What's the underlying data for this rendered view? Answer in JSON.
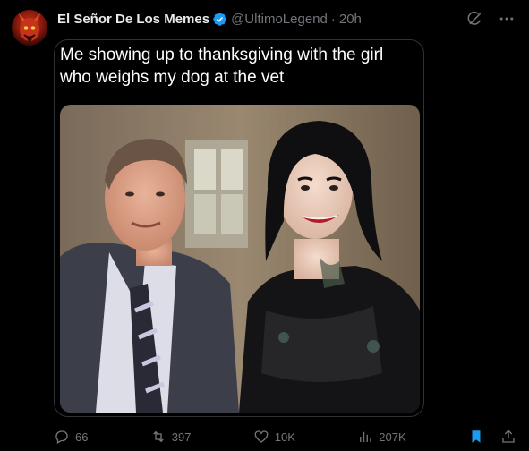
{
  "tweet": {
    "display_name": "El Señor De Los Memes",
    "handle": "@UltimoLegend",
    "separator": "·",
    "time": "20h",
    "verified_color": "#1d9bf0"
  },
  "meme": {
    "caption": "Me showing up to thanksgiving with the girl who weighs my dog at the vet"
  },
  "actions": {
    "replies": "66",
    "retweets": "397",
    "likes": "10K",
    "views": "207K",
    "bookmark_color": "#1d9bf0"
  },
  "icons": {
    "grok": "grok-icon",
    "more": "more-icon",
    "reply": "reply-icon",
    "retweet": "retweet-icon",
    "like": "like-icon",
    "views": "views-icon",
    "bookmark": "bookmark-icon",
    "share": "share-icon"
  }
}
